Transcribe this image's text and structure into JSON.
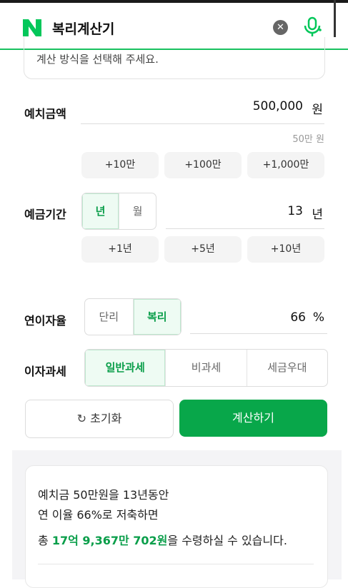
{
  "header": {
    "title": "복리계산기",
    "clear_icon": "close-icon",
    "mic_icon": "mic-icon",
    "brand_color": "#03c75a"
  },
  "method": {
    "text": "계산 방식을 선택해 주세요."
  },
  "deposit": {
    "label": "예치금액",
    "value": "500,000",
    "unit": "원",
    "hint": "50만 원",
    "chips": [
      "+10만",
      "+100만",
      "+1,000만"
    ]
  },
  "period": {
    "label": "예금기간",
    "options": [
      "년",
      "월"
    ],
    "selected": "년",
    "value": "13",
    "unit": "년",
    "chips": [
      "+1년",
      "+5년",
      "+10년"
    ]
  },
  "rate": {
    "label": "연이자율",
    "options": [
      "단리",
      "복리"
    ],
    "selected": "복리",
    "value": "66",
    "unit": "%"
  },
  "tax": {
    "label": "이자과세",
    "options": [
      "일반과세",
      "비과세",
      "세금우대"
    ],
    "selected": "일반과세"
  },
  "buttons": {
    "reset": "초기화",
    "calc": "계산하기"
  },
  "result": {
    "line1": "예치금 50만원을 13년동안",
    "line2": "연 이율 66%로 저축하면",
    "line3_prefix": "총 ",
    "line3_amount": "17억 9,367만 702원",
    "line3_suffix": "을 수령하실 수 있습니다."
  }
}
